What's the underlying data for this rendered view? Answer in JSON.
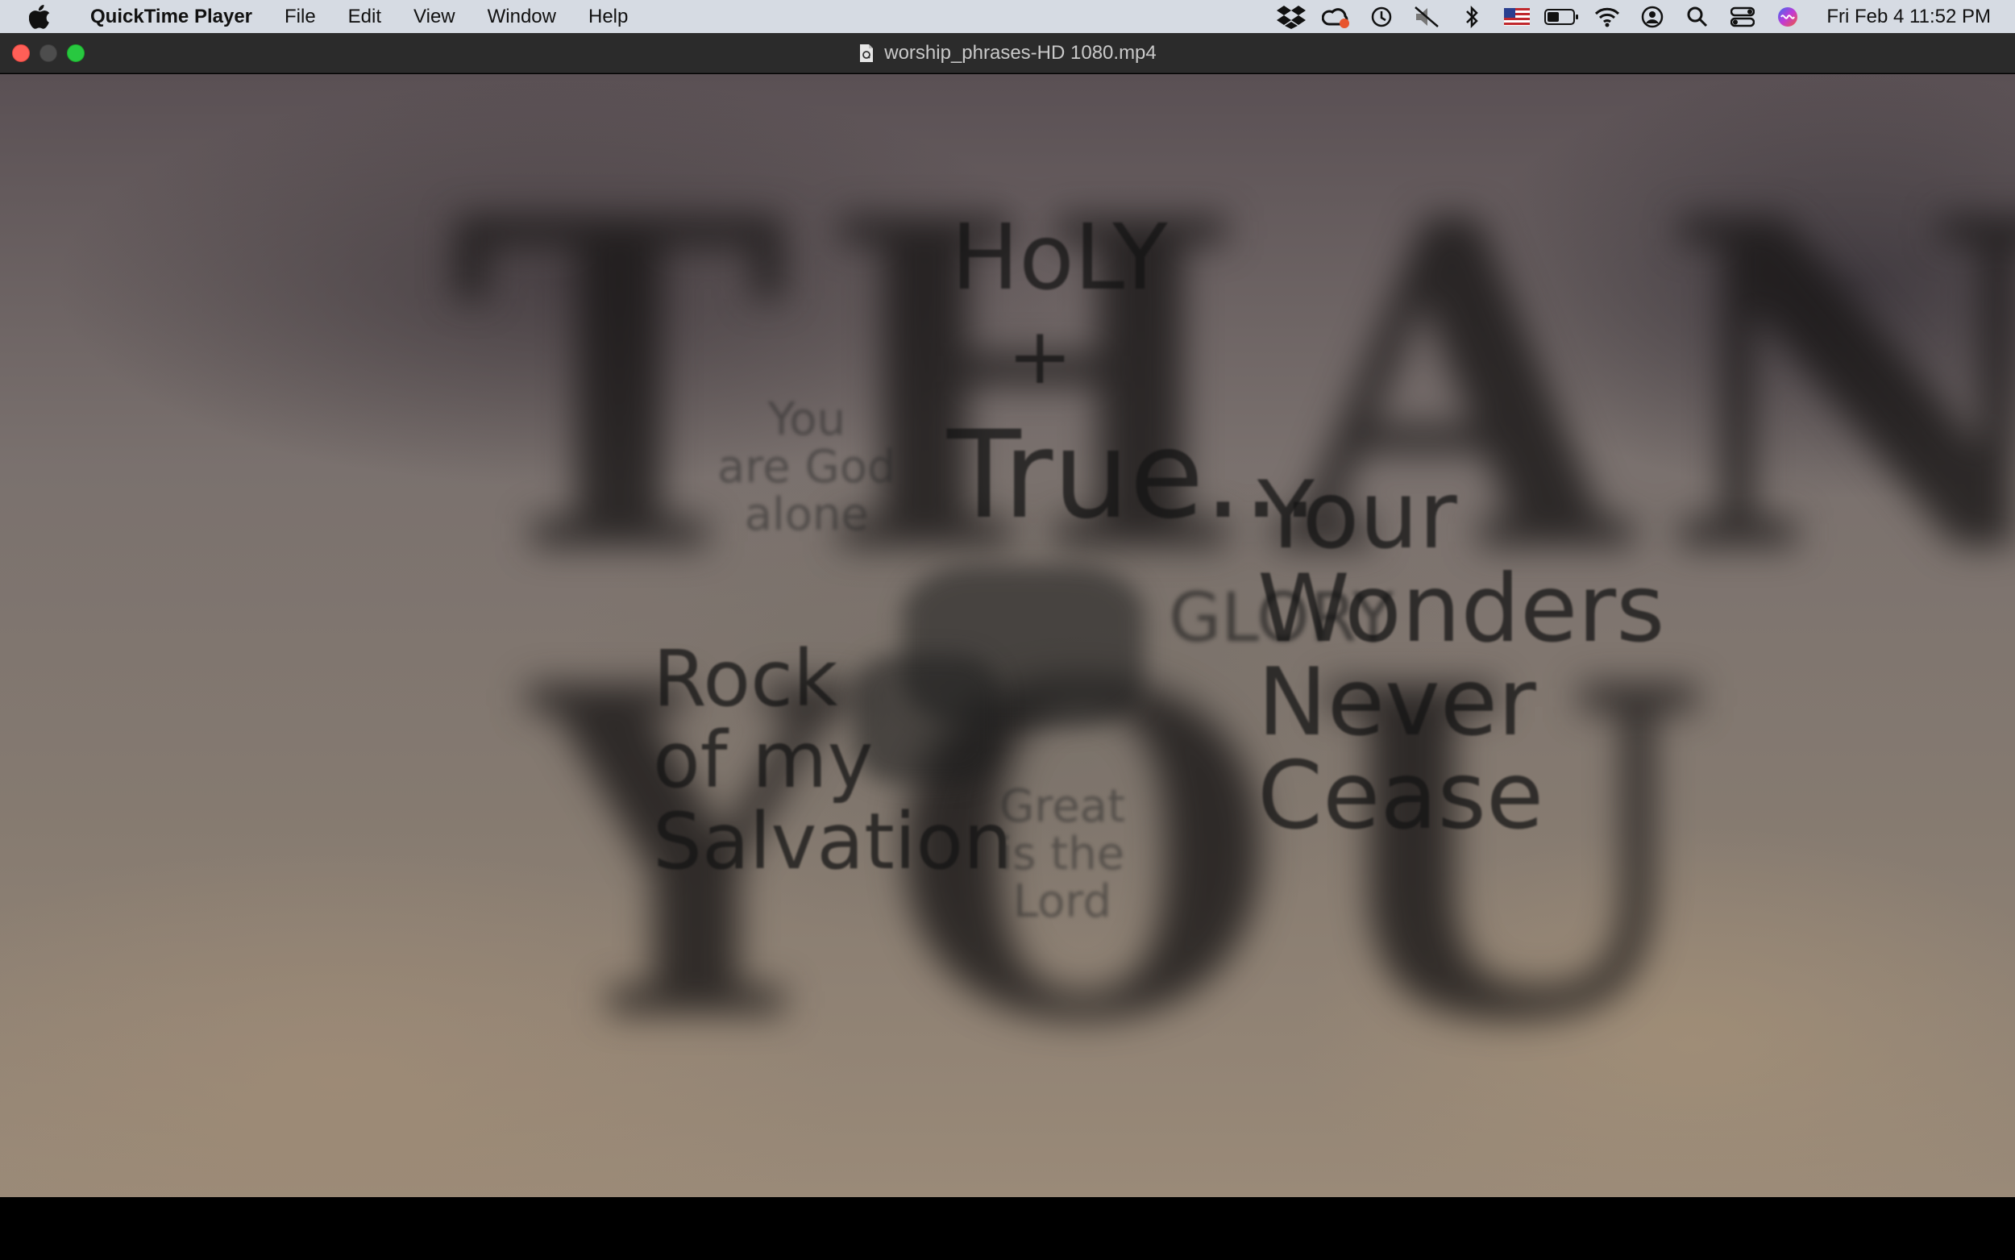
{
  "menubar": {
    "app_name": "QuickTime Player",
    "items": [
      "File",
      "Edit",
      "View",
      "Window",
      "Help"
    ],
    "clock": "Fri Feb 4  11:52 PM",
    "tray_icons": [
      "dropbox-icon",
      "creative-cloud-icon",
      "time-machine-icon",
      "mute-icon",
      "bluetooth-icon",
      "us-flag-icon",
      "battery-icon",
      "wifi-icon",
      "user-icon",
      "spotlight-search-icon",
      "control-center-icon",
      "siri-icon"
    ]
  },
  "window": {
    "title": "worship_phrases-HD 1080.mp4"
  },
  "video": {
    "background_words": [
      "THANK",
      "YOU"
    ],
    "phrases": {
      "holy": "HoLY",
      "ampersand": "+",
      "true": "True...",
      "god_alone": "You\nare God\nalone",
      "rock": "Rock\nof my\nSalvation",
      "great": "Great\nis the\nLord",
      "glory": "GLORY",
      "wonders": "Your\nWonders\nNever\nCease"
    }
  },
  "colors": {
    "menubar_bg": "#d6dbe3",
    "titlebar_bg": "#2b2b2b",
    "close": "#ff5f57",
    "maximize": "#28c840"
  }
}
